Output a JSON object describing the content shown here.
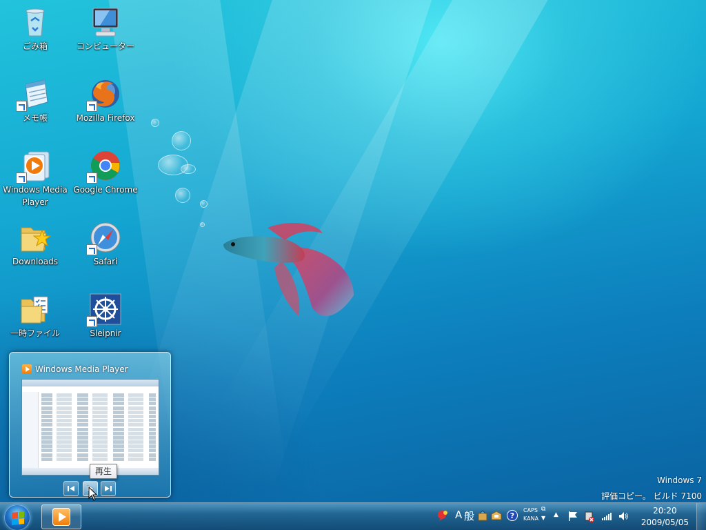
{
  "desktop": {
    "icons": [
      {
        "label": "ごみ箱"
      },
      {
        "label": "コンピューター"
      },
      {
        "label": "メモ帳"
      },
      {
        "label": "Mozilla Firefox"
      },
      {
        "label": "Windows Media Player"
      },
      {
        "label": "Google Chrome"
      },
      {
        "label": "Downloads"
      },
      {
        "label": "Safari"
      },
      {
        "label": "一時ファイル"
      },
      {
        "label": "Sleipnir"
      }
    ]
  },
  "preview": {
    "title": "Windows Media Player",
    "tooltip": "再生",
    "controls": [
      "previous-track",
      "play",
      "next-track"
    ]
  },
  "watermark": {
    "line1": "Windows 7",
    "line2": "評価コピー。 ビルド 7100"
  },
  "tray": {
    "ime_mode": "A",
    "ime_label": "般",
    "caps": "CAPS",
    "kana": "KANA",
    "time": "20:20",
    "date": "2009/05/05"
  },
  "colors": {
    "accent": "#1c6fc4",
    "wmp_orange": "#f07b0a"
  }
}
